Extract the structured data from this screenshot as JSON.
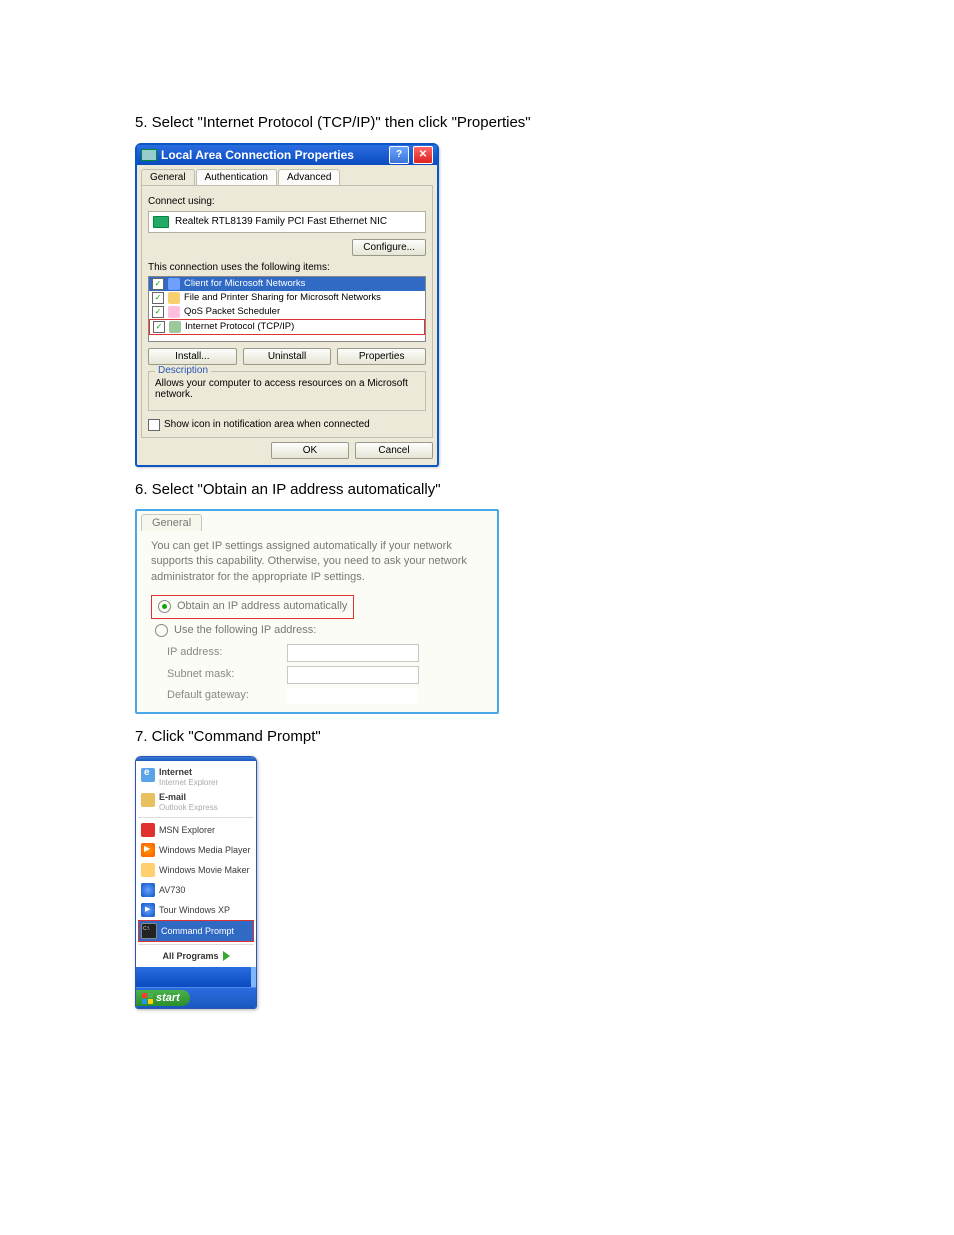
{
  "instructions": {
    "step5": "5.  Select \"Internet Protocol (TCP/IP)\" then click \"Properties\"",
    "step6": "6.  Select \"Obtain an IP address automatically\"",
    "step7": "7.  Click \"Command Prompt\""
  },
  "dialog1": {
    "title_icon": "network-icon",
    "title": "Local Area Connection Properties",
    "tabs": [
      "General",
      "Authentication",
      "Advanced"
    ],
    "connect_using_label": "Connect using:",
    "adapter": "Realtek RTL8139 Family PCI Fast Ethernet NIC",
    "configure_btn": "Configure...",
    "uses_label": "This connection uses the following items:",
    "items": [
      {
        "label": "Client for Microsoft Networks",
        "iconClass": "client"
      },
      {
        "label": "File and Printer Sharing for Microsoft Networks",
        "iconClass": "fileprint"
      },
      {
        "label": "QoS Packet Scheduler",
        "iconClass": "qos"
      },
      {
        "label": "Internet Protocol (TCP/IP)",
        "iconClass": "tcpip"
      }
    ],
    "install_btn": "Install...",
    "uninstall_btn": "Uninstall",
    "properties_btn": "Properties",
    "description_legend": "Description",
    "description_text": "Allows your computer to access resources on a Microsoft network.",
    "show_icon_label": "Show icon in notification area when connected",
    "ok": "OK",
    "cancel": "Cancel"
  },
  "dialog2": {
    "tab": "General",
    "intro": "You can get IP settings assigned automatically if your network supports this capability. Otherwise, you need to ask your network administrator for the appropriate IP settings.",
    "radio_auto": "Obtain an IP address automatically",
    "radio_manual": "Use the following IP address:",
    "ip_label": "IP address:",
    "subnet_label": "Subnet mask:",
    "gateway_label": "Default gateway:"
  },
  "startmenu": {
    "items": [
      {
        "title": "Internet",
        "subtitle": "Internet Explorer",
        "iconClass": "ico-ie"
      },
      {
        "title": "E-mail",
        "subtitle": "Outlook Express",
        "iconClass": "ico-mail"
      },
      {
        "title": "MSN Explorer",
        "subtitle": "",
        "iconClass": "ico-msn"
      },
      {
        "title": "Windows Media Player",
        "subtitle": "",
        "iconClass": "ico-wmp"
      },
      {
        "title": "Windows Movie Maker",
        "subtitle": "",
        "iconClass": "ico-movie"
      },
      {
        "title": "AV730",
        "subtitle": "",
        "iconClass": "ico-av"
      },
      {
        "title": "Tour Windows XP",
        "subtitle": "",
        "iconClass": "ico-tour"
      },
      {
        "title": "Command Prompt",
        "subtitle": "",
        "iconClass": "ico-cmd"
      }
    ],
    "all_programs": "All Programs",
    "start": "start"
  }
}
